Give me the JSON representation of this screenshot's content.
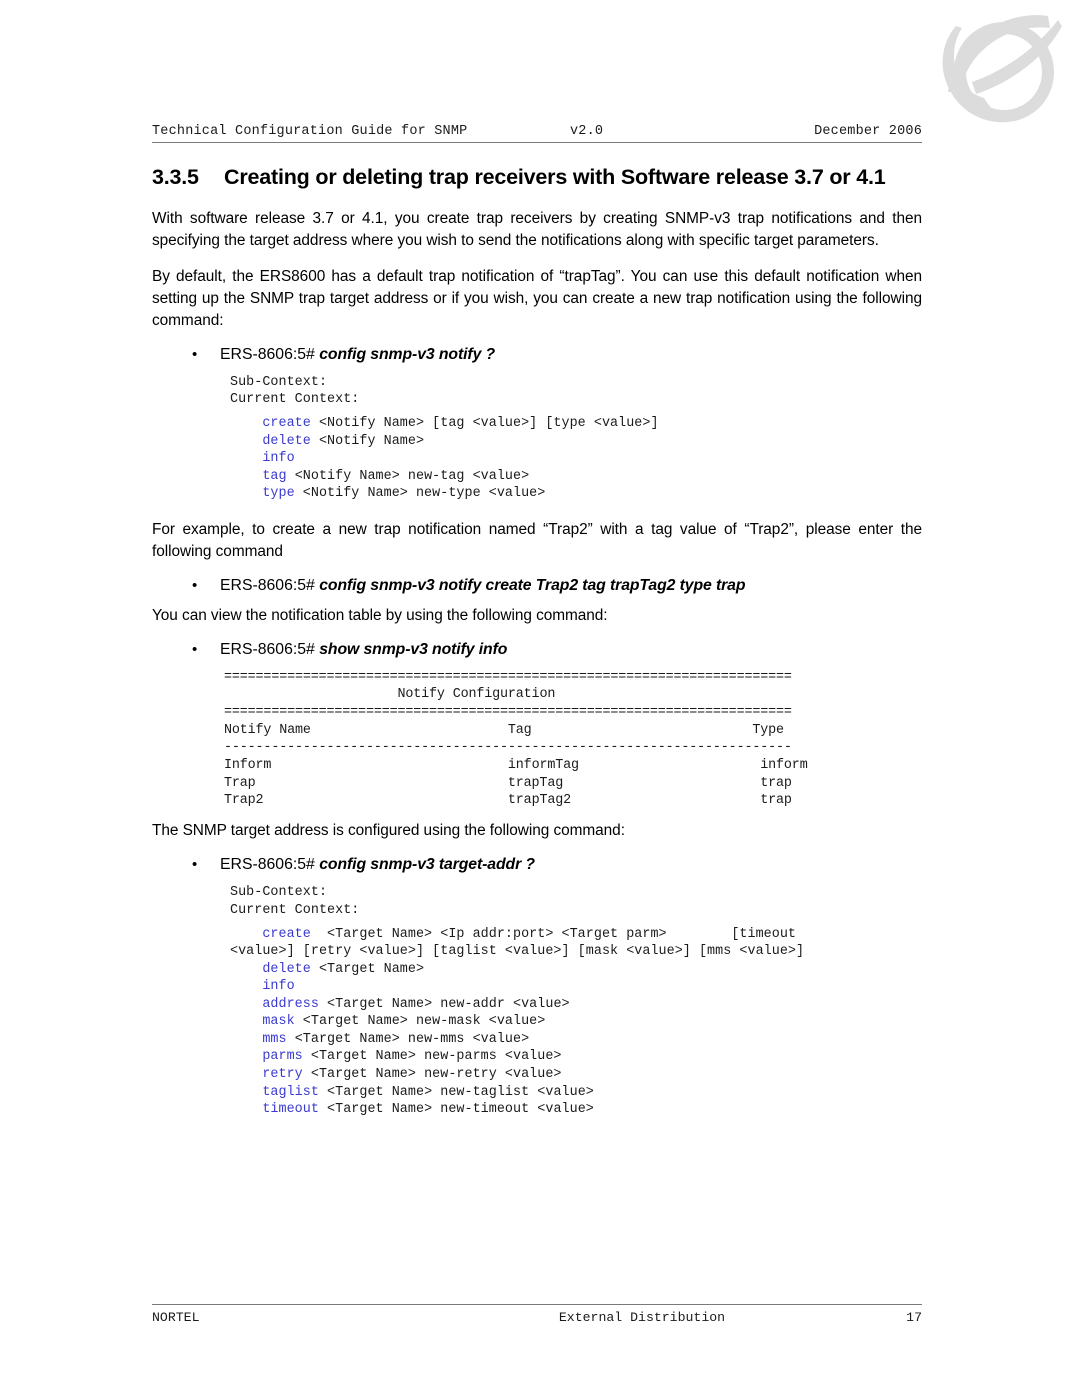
{
  "header": {
    "left": "Technical Configuration Guide for SNMP",
    "version": "v2.0",
    "date": "December 2006"
  },
  "logo": {
    "name": "nortel-globemark-logo",
    "color": "#dcdcdc"
  },
  "section": {
    "number": "3.3.5",
    "title": "Creating or deleting trap receivers with Software release 3.7 or 4.1"
  },
  "paragraphs": {
    "p1": "With software release 3.7 or 4.1, you create trap receivers by creating SNMP-v3 trap notifications and then specifying the target address where you wish to send the notifications along with specific target parameters.",
    "p2": "By default, the ERS8600 has a default trap notification of “trapTag”. You can use this default notification when setting up the SNMP trap target address or if you wish, you can create a new trap notification using the following command:",
    "p3": "For example, to create a new trap notification named “Trap2” with a tag value of “Trap2”, please enter the following command",
    "p4": "You can view the notification table by using the following command:",
    "p5": "The SNMP target address is configured using the following command:"
  },
  "bullets": {
    "b1": {
      "dot": "•",
      "prompt": "ERS-8606:5# ",
      "command": "config snmp-v3 notify ?"
    },
    "b2": {
      "dot": "•",
      "prompt": "ERS-8606:5# ",
      "command": "config snmp-v3 notify create Trap2 tag trapTag2 type trap"
    },
    "b3": {
      "dot": "•",
      "prompt": "ERS-8606:5# ",
      "command": "show snmp-v3 notify info"
    },
    "b4": {
      "dot": "•",
      "prompt": "ERS-8606:5# ",
      "command": "config snmp-v3 target-addr ?"
    }
  },
  "code_notify": {
    "context_sub": "Sub-Context:",
    "context_current": "Current Context:",
    "lines": [
      {
        "keyword": "create",
        "rest": " <Notify Name> [tag <value>] [type <value>]"
      },
      {
        "keyword": "delete",
        "rest": " <Notify Name>"
      },
      {
        "keyword": "info",
        "rest": ""
      },
      {
        "keyword": "tag",
        "rest": " <Notify Name> new-tag <value>"
      },
      {
        "keyword": "type",
        "rest": " <Notify Name> new-type <value>"
      }
    ]
  },
  "notify_table": {
    "rule_equals": "========================================================================",
    "rule_dashes": "------------------------------------------------------------------------",
    "title": "Notify Configuration",
    "columns": [
      "Notify Name",
      "Tag",
      "Type"
    ],
    "rows": [
      [
        "Inform",
        "informTag",
        "inform"
      ],
      [
        "Trap",
        "trapTag",
        "trap"
      ],
      [
        "Trap2",
        "trapTag2",
        "trap"
      ]
    ]
  },
  "code_target": {
    "context_sub": "Sub-Context:",
    "context_current": "Current Context:",
    "create_keyword": "create",
    "create_rest_line1": "  <Target Name> <Ip addr:port> <Target parm>        [timeout",
    "create_rest_line2": "<value>] [retry <value>] [taglist <value>] [mask <value>] [mms <value>]",
    "lines": [
      {
        "keyword": "delete",
        "rest": " <Target Name>"
      },
      {
        "keyword": "info",
        "rest": ""
      },
      {
        "keyword": "address",
        "rest": " <Target Name> new-addr <value>"
      },
      {
        "keyword": "mask",
        "rest": " <Target Name> new-mask <value>"
      },
      {
        "keyword": "mms",
        "rest": " <Target Name> new-mms <value>"
      },
      {
        "keyword": "parms",
        "rest": " <Target Name> new-parms <value>"
      },
      {
        "keyword": "retry",
        "rest": " <Target Name> new-retry <value>"
      },
      {
        "keyword": "taglist",
        "rest": " <Target Name> new-taglist <value>"
      },
      {
        "keyword": "timeout",
        "rest": " <Target Name> new-timeout <value>"
      }
    ]
  },
  "footer": {
    "left": "NORTEL",
    "center": "External Distribution",
    "page": "17"
  }
}
